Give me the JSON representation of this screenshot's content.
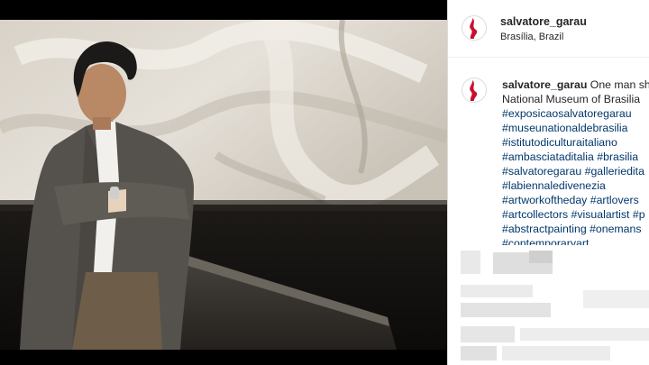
{
  "post": {
    "image_alt": "Salvatore Garau standing with arms crossed in front of a large abstract painting"
  },
  "header": {
    "username": "salvatore_garau",
    "location": "Brasília, Brazil"
  },
  "caption": {
    "username": "salvatore_garau",
    "text_line1": "One man sh",
    "text_line2": "National Museum of Brasilia",
    "hashtag_lines": [
      "#exposicaosalvatoregarau",
      "#museunationaldebrasilia",
      "#istitutodiculturaitaliano",
      "#ambasciataditalia #brasilia",
      "#salvatoregarau #galleriedita",
      "#labiennaledivenezia",
      "#artworkoftheday #artlovers",
      "#artcollectors #visualartist #p",
      "#abstractpainting #onemans",
      "#contemporaryart"
    ]
  },
  "colors": {
    "link": "#00376b",
    "text": "#262626",
    "avatar_accent": "#c8102e"
  },
  "icons": {
    "avatar": "red-brushstroke-avatar"
  }
}
